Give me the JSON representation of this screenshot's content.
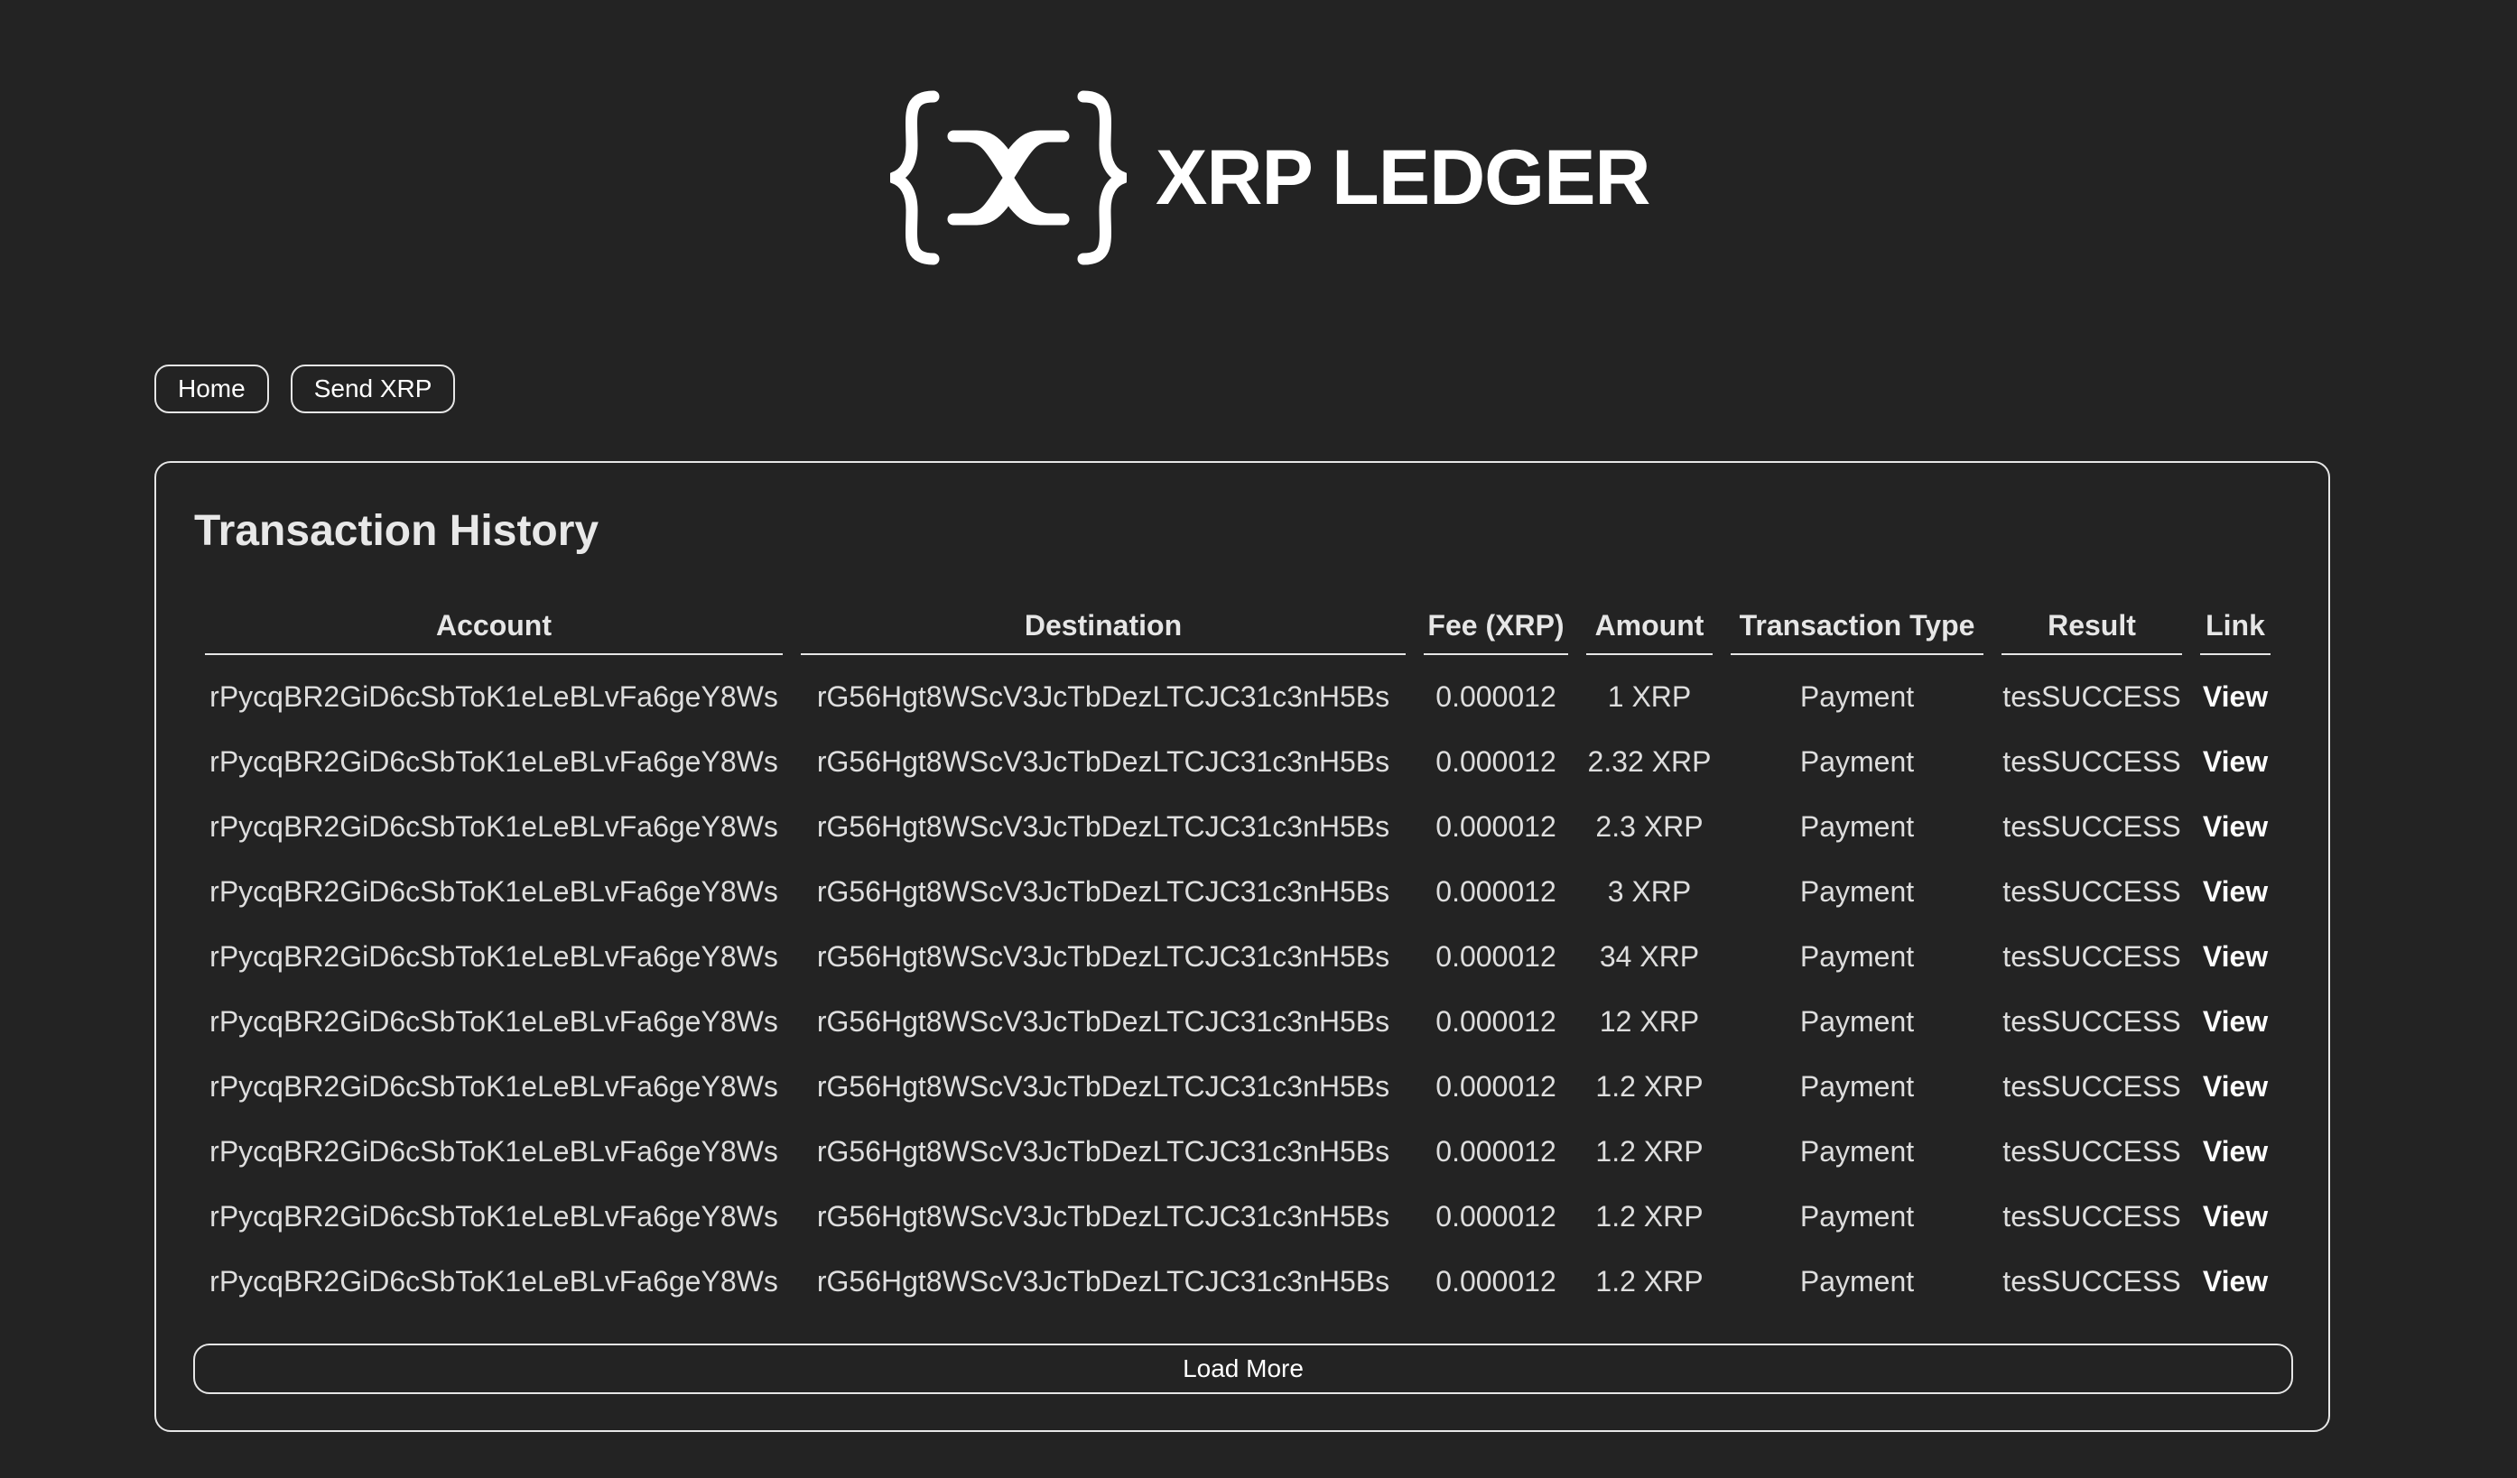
{
  "header": {
    "logo_icon": "xrp-brace-logo-icon",
    "title": "XRP LEDGER"
  },
  "nav": {
    "home_label": "Home",
    "send_label": "Send XRP"
  },
  "transactions": {
    "title": "Transaction History",
    "columns": [
      "Account",
      "Destination",
      "Fee (XRP)",
      "Amount",
      "Transaction Type",
      "Result",
      "Link"
    ],
    "rows": [
      {
        "account": "rPycqBR2GiD6cSbToK1eLeBLvFa6geY8Ws",
        "destination": "rG56Hgt8WScV3JcTbDezLTCJC31c3nH5Bs",
        "fee": "0.000012",
        "amount": "1 XRP",
        "type": "Payment",
        "result": "tesSUCCESS",
        "link": "View"
      },
      {
        "account": "rPycqBR2GiD6cSbToK1eLeBLvFa6geY8Ws",
        "destination": "rG56Hgt8WScV3JcTbDezLTCJC31c3nH5Bs",
        "fee": "0.000012",
        "amount": "2.32 XRP",
        "type": "Payment",
        "result": "tesSUCCESS",
        "link": "View"
      },
      {
        "account": "rPycqBR2GiD6cSbToK1eLeBLvFa6geY8Ws",
        "destination": "rG56Hgt8WScV3JcTbDezLTCJC31c3nH5Bs",
        "fee": "0.000012",
        "amount": "2.3 XRP",
        "type": "Payment",
        "result": "tesSUCCESS",
        "link": "View"
      },
      {
        "account": "rPycqBR2GiD6cSbToK1eLeBLvFa6geY8Ws",
        "destination": "rG56Hgt8WScV3JcTbDezLTCJC31c3nH5Bs",
        "fee": "0.000012",
        "amount": "3 XRP",
        "type": "Payment",
        "result": "tesSUCCESS",
        "link": "View"
      },
      {
        "account": "rPycqBR2GiD6cSbToK1eLeBLvFa6geY8Ws",
        "destination": "rG56Hgt8WScV3JcTbDezLTCJC31c3nH5Bs",
        "fee": "0.000012",
        "amount": "34 XRP",
        "type": "Payment",
        "result": "tesSUCCESS",
        "link": "View"
      },
      {
        "account": "rPycqBR2GiD6cSbToK1eLeBLvFa6geY8Ws",
        "destination": "rG56Hgt8WScV3JcTbDezLTCJC31c3nH5Bs",
        "fee": "0.000012",
        "amount": "12 XRP",
        "type": "Payment",
        "result": "tesSUCCESS",
        "link": "View"
      },
      {
        "account": "rPycqBR2GiD6cSbToK1eLeBLvFa6geY8Ws",
        "destination": "rG56Hgt8WScV3JcTbDezLTCJC31c3nH5Bs",
        "fee": "0.000012",
        "amount": "1.2 XRP",
        "type": "Payment",
        "result": "tesSUCCESS",
        "link": "View"
      },
      {
        "account": "rPycqBR2GiD6cSbToK1eLeBLvFa6geY8Ws",
        "destination": "rG56Hgt8WScV3JcTbDezLTCJC31c3nH5Bs",
        "fee": "0.000012",
        "amount": "1.2 XRP",
        "type": "Payment",
        "result": "tesSUCCESS",
        "link": "View"
      },
      {
        "account": "rPycqBR2GiD6cSbToK1eLeBLvFa6geY8Ws",
        "destination": "rG56Hgt8WScV3JcTbDezLTCJC31c3nH5Bs",
        "fee": "0.000012",
        "amount": "1.2 XRP",
        "type": "Payment",
        "result": "tesSUCCESS",
        "link": "View"
      },
      {
        "account": "rPycqBR2GiD6cSbToK1eLeBLvFa6geY8Ws",
        "destination": "rG56Hgt8WScV3JcTbDezLTCJC31c3nH5Bs",
        "fee": "0.000012",
        "amount": "1.2 XRP",
        "type": "Payment",
        "result": "tesSUCCESS",
        "link": "View"
      }
    ],
    "load_more_label": "Load More"
  },
  "colors": {
    "background": "#232323",
    "text": "#ffffff",
    "border": "#e6e6e6"
  }
}
